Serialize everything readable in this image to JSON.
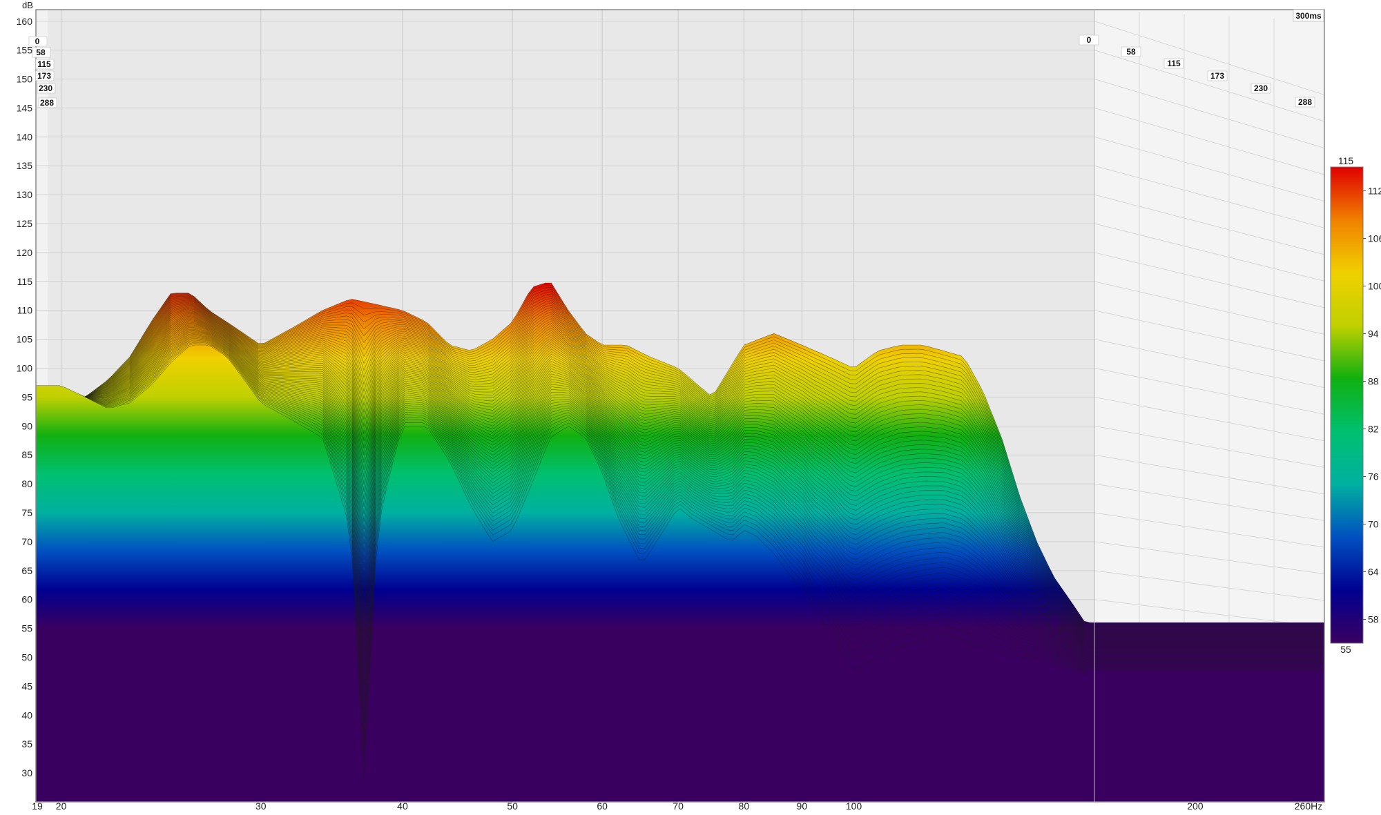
{
  "chart_data": {
    "type": "waterfall",
    "x_unit": "Hz",
    "y_unit": "dB",
    "x_range": [
      19,
      260
    ],
    "y_range": [
      25,
      162
    ],
    "x_scale": "log",
    "time_unit": "ms",
    "time_range": [
      0,
      300
    ],
    "time_label_max": "300ms",
    "x_ticks": [
      {
        "value": 19,
        "label": "19"
      },
      {
        "value": 20,
        "label": "20"
      },
      {
        "value": 30,
        "label": "30"
      },
      {
        "value": 40,
        "label": "40"
      },
      {
        "value": 50,
        "label": "50"
      },
      {
        "value": 60,
        "label": "60"
      },
      {
        "value": 70,
        "label": "70"
      },
      {
        "value": 80,
        "label": "80"
      },
      {
        "value": 90,
        "label": "90"
      },
      {
        "value": 100,
        "label": "100"
      },
      {
        "value": 200,
        "label": "200"
      },
      {
        "value": 260,
        "label": "260Hz"
      }
    ],
    "y_ticks": [
      30,
      35,
      40,
      45,
      50,
      55,
      60,
      65,
      70,
      75,
      80,
      85,
      90,
      95,
      100,
      105,
      110,
      115,
      120,
      125,
      130,
      135,
      140,
      145,
      150,
      155,
      160
    ],
    "time_slices": [
      "0",
      "58",
      "115",
      "173",
      "230",
      "288"
    ],
    "time_slices_left": [
      "0",
      "58",
      "115",
      "173",
      "230",
      "288"
    ],
    "legend": {
      "min": 55,
      "max": 115,
      "ticks": [
        58,
        64,
        70,
        76,
        82,
        88,
        94,
        100,
        106,
        112
      ],
      "colors": [
        "#3a0060",
        "#000090",
        "#0050c0",
        "#00b0a0",
        "#00c070",
        "#10b010",
        "#c0d000",
        "#f0d000",
        "#f08000",
        "#e00000"
      ]
    },
    "series": [
      {
        "name": "0",
        "x": [
          19.3,
          20,
          21,
          22,
          23,
          24,
          25,
          26,
          27,
          28,
          29,
          30,
          32,
          34,
          35,
          36,
          37,
          38,
          39,
          40,
          42,
          44,
          46,
          48,
          50,
          52,
          54,
          56,
          58,
          60,
          62,
          65,
          68,
          70,
          72,
          75,
          78,
          80,
          82,
          85,
          88,
          90,
          92,
          95,
          98,
          100,
          105,
          110,
          115,
          120,
          125,
          130,
          135,
          140,
          145,
          150,
          155,
          160
        ],
        "y": [
          97,
          97,
          95,
          93,
          94,
          97,
          101,
          104,
          104,
          102,
          98,
          94,
          91,
          88,
          80,
          72,
          28,
          72,
          82,
          90,
          90,
          84,
          76,
          70,
          72,
          80,
          88,
          90,
          88,
          82,
          74,
          66,
          72,
          76,
          74,
          72,
          70,
          72,
          71,
          68,
          64,
          62,
          58,
          55,
          50,
          48,
          50,
          52,
          53,
          54,
          53,
          52,
          51,
          50,
          50,
          49,
          48,
          47
        ]
      },
      {
        "name": "288",
        "x": [
          19.3,
          20,
          21,
          22,
          23,
          24,
          25,
          26,
          27,
          28,
          30,
          32,
          34,
          36,
          38,
          40,
          42,
          44,
          46,
          48,
          50,
          52,
          54,
          56,
          58,
          60,
          63,
          66,
          70,
          75,
          80,
          85,
          90,
          95,
          100,
          105,
          110,
          115,
          120,
          125,
          130,
          135,
          140,
          145,
          150,
          155,
          160
        ],
        "y": [
          90,
          93,
          95,
          98,
          102,
          108,
          113,
          113,
          110,
          108,
          104,
          107,
          110,
          112,
          111,
          110,
          108,
          104,
          103,
          105,
          108,
          114,
          115,
          110,
          106,
          104,
          104,
          102,
          100,
          95,
          104,
          106,
          104,
          102,
          100,
          103,
          104,
          104,
          103,
          102,
          96,
          88,
          78,
          70,
          64,
          60,
          56
        ]
      }
    ]
  }
}
